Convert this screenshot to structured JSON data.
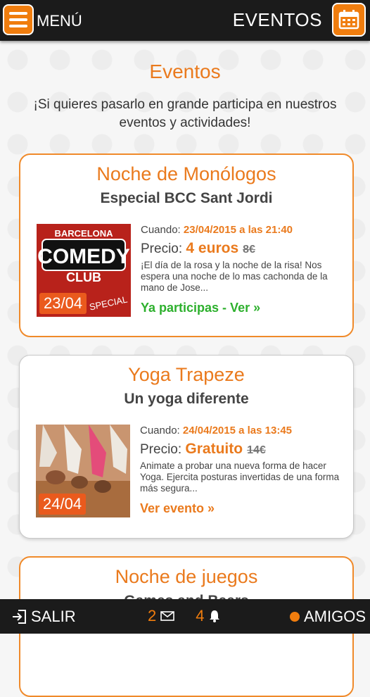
{
  "topbar": {
    "menu_label": "MENÚ",
    "section_label": "EVENTOS"
  },
  "page": {
    "title": "Eventos",
    "intro": "¡Si quieres pasarlo en grande participa en nuestros eventos y actividades!"
  },
  "events": [
    {
      "title": "Noche de Monólogos",
      "subtitle": "Especial BCC Sant Jordi",
      "date_badge": "23/04",
      "image_text_top": "BARCELONA",
      "image_text_main": "COMEDY",
      "image_text_bottom": "CLUB",
      "image_text_special": "SPECIAL",
      "when_label": "Cuando:",
      "when_value": "23/04/2015 a las 21:40",
      "price_label": "Precio:",
      "price_value": "4 euros",
      "price_old": "8€",
      "description": "¡El día de la rosa y la noche de la risa! Nos espera una noche de lo mas cachonda de la mano de Jose...",
      "cta": "Ya participas - Ver »"
    },
    {
      "title": "Yoga Trapeze",
      "subtitle": "Un yoga diferente",
      "date_badge": "24/04",
      "when_label": "Cuando:",
      "when_value": "24/04/2015 a las 13:45",
      "price_label": "Precio:",
      "price_value": "Gratuito",
      "price_old": "14€",
      "description": "Animate a probar una nueva forma de hacer Yoga. Ejercita posturas invertidas de una forma más segura...",
      "cta": "Ver evento »"
    },
    {
      "title": "Noche de juegos",
      "subtitle": "Games and Beers"
    }
  ],
  "bottombar": {
    "exit_label": "SALIR",
    "messages_count": "2",
    "notifications_count": "4",
    "friends_label": "AMIGOS"
  },
  "colors": {
    "accent": "#f07d0e",
    "bar": "#1b1b1b",
    "green": "#2db02d"
  }
}
